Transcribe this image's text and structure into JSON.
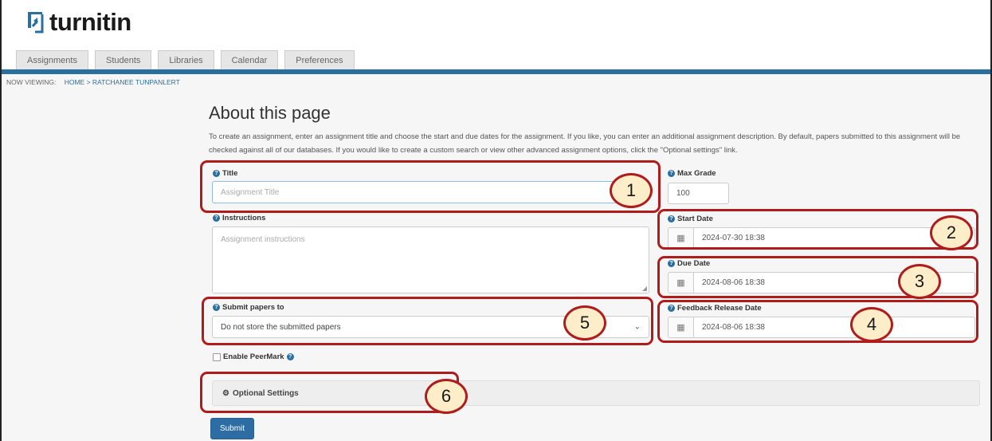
{
  "app": {
    "logo_text": "turnitin"
  },
  "tabs": [
    {
      "label": "Assignments"
    },
    {
      "label": "Students"
    },
    {
      "label": "Libraries"
    },
    {
      "label": "Calendar"
    },
    {
      "label": "Preferences"
    }
  ],
  "breadcrumb": {
    "prefix": "NOW VIEWING:",
    "path": "HOME > RATCHANEE TUNPANLERT"
  },
  "page": {
    "title": "About this page",
    "description": "To create an assignment, enter an assignment title and choose the start and due dates for the assignment. If you like, you can enter an additional assignment description. By default, papers submitted to this assignment will be checked against all of our databases. If you would like to create a custom search or view other advanced assignment options, click the \"Optional settings\" link."
  },
  "form": {
    "title": {
      "label": "Title",
      "placeholder": "Assignment Title"
    },
    "max_grade": {
      "label": "Max Grade",
      "value": "100"
    },
    "instructions": {
      "label": "Instructions",
      "placeholder": "Assignment instructions"
    },
    "start_date": {
      "label": "Start Date",
      "value": "2024-07-30 18:38"
    },
    "due_date": {
      "label": "Due Date",
      "value": "2024-08-06 18:38"
    },
    "feedback_date": {
      "label": "Feedback Release Date",
      "value": "2024-08-06 18:38"
    },
    "submit_papers": {
      "label": "Submit papers to",
      "selected": "Do not store the submitted papers"
    },
    "peermark": {
      "label": "Enable PeerMark",
      "checked": false
    },
    "optional_settings": {
      "label": "Optional Settings"
    },
    "submit_label": "Submit"
  },
  "callouts": [
    "1",
    "2",
    "3",
    "4",
    "5",
    "6"
  ],
  "colors": {
    "accent": "#2b6fa0",
    "highlight": "#b01c1c",
    "badge_fill": "#fdeec9",
    "submit": "#2e6da4"
  }
}
